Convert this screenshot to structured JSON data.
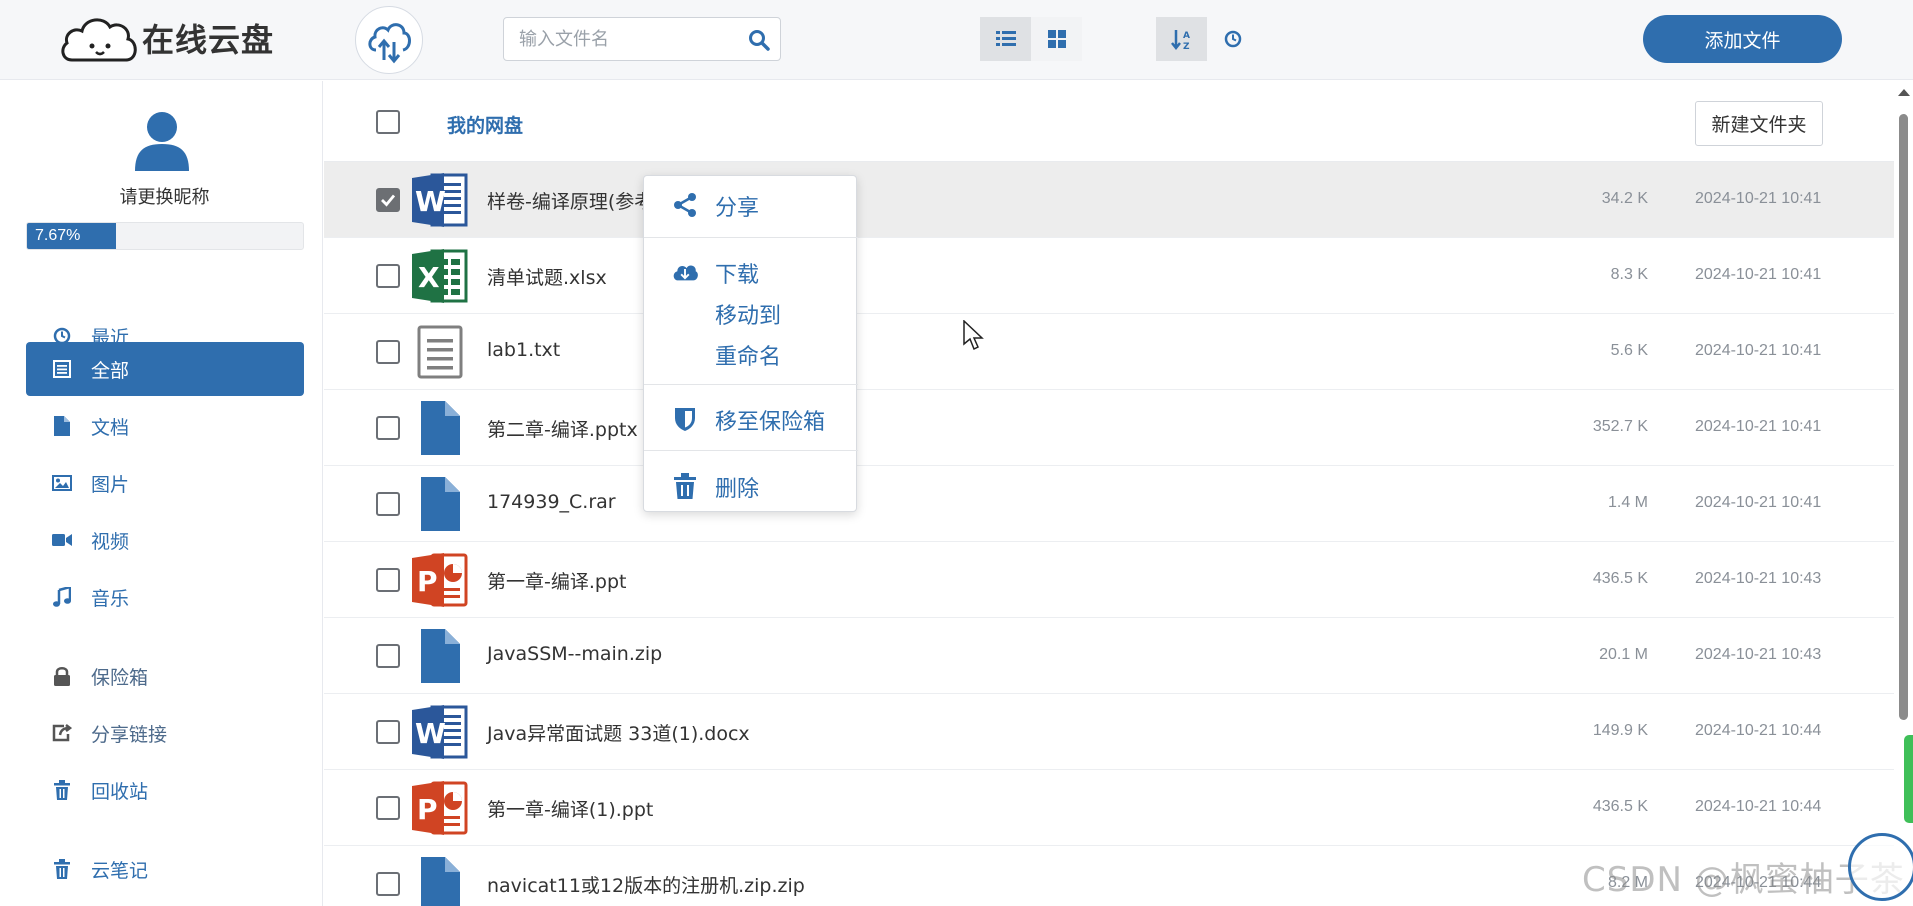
{
  "header": {
    "app_title": "在线云盘",
    "search_placeholder": "输入文件名",
    "add_file_label": "添加文件"
  },
  "sidebar": {
    "nickname": "请更换昵称",
    "quota_percent": "7.67%",
    "quota_value": 7.67,
    "items": [
      {
        "label": "最近",
        "icon": "clock-icon"
      },
      {
        "label": "全部",
        "icon": "list-icon",
        "active": true
      },
      {
        "label": "文档",
        "icon": "document-icon"
      },
      {
        "label": "图片",
        "icon": "image-icon"
      },
      {
        "label": "视频",
        "icon": "video-icon"
      },
      {
        "label": "音乐",
        "icon": "music-icon"
      }
    ],
    "items2": [
      {
        "label": "保险箱",
        "icon": "lock-icon"
      },
      {
        "label": "分享链接",
        "icon": "share-link-icon"
      },
      {
        "label": "回收站",
        "icon": "trash-icon"
      }
    ],
    "items3": [
      {
        "label": "云笔记",
        "icon": "trash-icon"
      }
    ]
  },
  "main": {
    "breadcrumb": "我的网盘",
    "new_folder_label": "新建文件夹",
    "files": [
      {
        "name": "样卷-编译原理(参考",
        "size": "34.2 K",
        "date": "2024-10-21 10:41",
        "type": "word",
        "checked": true
      },
      {
        "name": "清单试题.xlsx",
        "size": "8.3 K",
        "date": "2024-10-21 10:41",
        "type": "excel",
        "checked": false
      },
      {
        "name": "lab1.txt",
        "size": "5.6 K",
        "date": "2024-10-21 10:41",
        "type": "text",
        "checked": false
      },
      {
        "name": "第二章-编译.pptx",
        "size": "352.7 K",
        "date": "2024-10-21 10:41",
        "type": "file",
        "checked": false
      },
      {
        "name": "174939_C.rar",
        "size": "1.4 M",
        "date": "2024-10-21 10:41",
        "type": "file",
        "checked": false
      },
      {
        "name": "第一章-编译.ppt",
        "size": "436.5 K",
        "date": "2024-10-21 10:43",
        "type": "ppt",
        "checked": false
      },
      {
        "name": "JavaSSM--main.zip",
        "size": "20.1 M",
        "date": "2024-10-21 10:43",
        "type": "file",
        "checked": false
      },
      {
        "name": "Java异常面试题 33道(1).docx",
        "size": "149.9 K",
        "date": "2024-10-21 10:44",
        "type": "word",
        "checked": false
      },
      {
        "name": "第一章-编译(1).ppt",
        "size": "436.5 K",
        "date": "2024-10-21 10:44",
        "type": "ppt",
        "checked": false
      },
      {
        "name": "navicat11或12版本的注册机.zip.zip",
        "size": "8.2 M",
        "date": "2024-10-21 10:44",
        "type": "file",
        "checked": false
      }
    ]
  },
  "context_menu": {
    "share": "分享",
    "download": "下载",
    "move_to": "移动到",
    "rename": "重命名",
    "move_to_vault": "移至保险箱",
    "delete": "删除"
  },
  "watermark": "CSDN @枫蜜柚子茶",
  "colors": {
    "accent": "#2f6eae",
    "word": "#2b579a",
    "excel": "#1f7244",
    "ppt": "#d04423",
    "scroll_green": "#3fbf58"
  }
}
